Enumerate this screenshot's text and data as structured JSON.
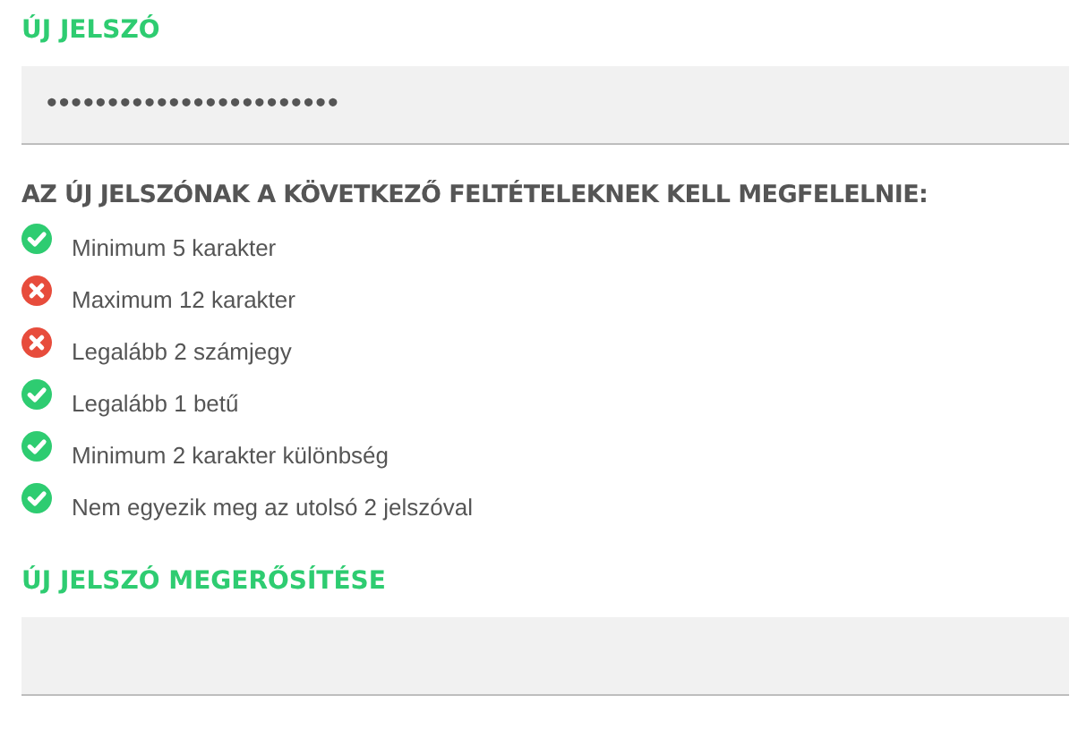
{
  "new_password": {
    "label": "ÚJ JELSZÓ",
    "value": "••••••••••••••••••••••••"
  },
  "requirements": {
    "title": "AZ ÚJ JELSZÓNAK A KÖVETKEZŐ FELTÉTELEKNEK KELL MEGFELELNIE:",
    "items": [
      {
        "text": "Minimum 5 karakter",
        "met": true
      },
      {
        "text": "Maximum 12 karakter",
        "met": false
      },
      {
        "text": "Legalább 2 számjegy",
        "met": false
      },
      {
        "text": "Legalább 1 betű",
        "met": true
      },
      {
        "text": "Minimum 2 karakter különbség",
        "met": true
      },
      {
        "text": "Nem egyezik meg az utolsó 2 jelszóval",
        "met": true
      }
    ]
  },
  "confirm_password": {
    "label": "ÚJ JELSZÓ MEGERŐSÍTÉSE"
  }
}
